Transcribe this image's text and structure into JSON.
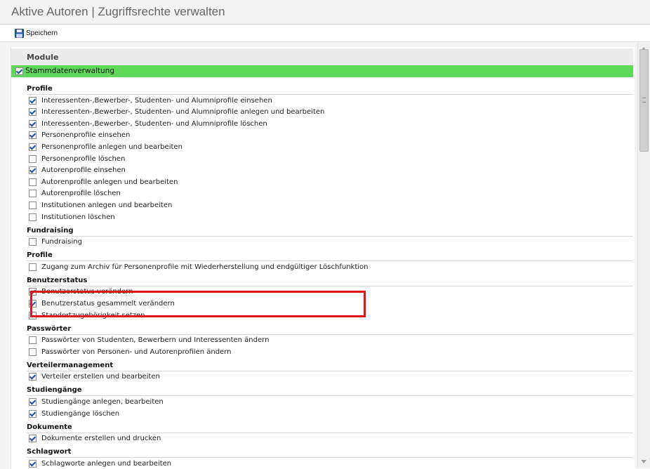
{
  "window": {
    "title": "Aktive Autoren | Zugriffsrechte verwalten"
  },
  "toolbar": {
    "save_label": "Speichern",
    "save_icon": "floppy-disk-icon"
  },
  "module_header": "Module",
  "module": {
    "label": "Stammdatenverwaltung",
    "checked": true,
    "highlight_color": "#5fd95a"
  },
  "groups": [
    {
      "title": "Profile",
      "items": [
        {
          "label": "Interessenten-,Bewerber-, Studenten- und Alumniprofile einsehen",
          "checked": true
        },
        {
          "label": "Interessenten-,Bewerber-, Studenten- und Alumniprofile anlegen und bearbeiten",
          "checked": true
        },
        {
          "label": "Interessenten-,Bewerber-, Studenten- und Alumniprofile löschen",
          "checked": true
        },
        {
          "label": "Personenprofile einsehen",
          "checked": true
        },
        {
          "label": "Personenprofile anlegen und bearbeiten",
          "checked": true
        },
        {
          "label": "Personenprofile löschen",
          "checked": false
        },
        {
          "label": "Autorenprofile einsehen",
          "checked": true
        },
        {
          "label": "Autorenprofile anlegen und bearbeiten",
          "checked": false
        },
        {
          "label": "Autorenprofile löschen",
          "checked": false
        },
        {
          "label": "Institutionen anlegen und bearbeiten",
          "checked": false
        },
        {
          "label": "Institutionen löschen",
          "checked": false
        }
      ]
    },
    {
      "title": "Fundraising",
      "items": [
        {
          "label": "Fundraising",
          "checked": false
        }
      ]
    },
    {
      "title": "Profile",
      "items": [
        {
          "label": "Zugang zum Archiv für Personenprofile mit Wiederherstellung und endgültiger Löschfunktion",
          "checked": false
        }
      ]
    },
    {
      "title": "Benutzerstatus",
      "items": [
        {
          "label": "Benutzerstatus verändern",
          "checked": true
        },
        {
          "label": "Benutzerstatus gesammelt verändern",
          "checked": true
        },
        {
          "label": "Standortzugehörigkeit setzen",
          "checked": false
        }
      ]
    },
    {
      "title": "Passwörter",
      "items": [
        {
          "label": "Passwörter von Studenten, Bewerbern und Interessenten ändern",
          "checked": false
        },
        {
          "label": "Passwörter von Personen- und Autorenprofilen ändern",
          "checked": false
        }
      ]
    },
    {
      "title": "Verteilermanagement",
      "items": [
        {
          "label": "Verteiler erstellen und bearbeiten",
          "checked": true
        }
      ]
    },
    {
      "title": "Studiengänge",
      "items": [
        {
          "label": "Studiengänge anlegen, bearbeiten",
          "checked": true
        },
        {
          "label": "Studiengänge löschen",
          "checked": true
        }
      ]
    },
    {
      "title": "Dokumente",
      "items": [
        {
          "label": "Dokumente erstellen und drucken",
          "checked": true
        }
      ]
    },
    {
      "title": "Schlagwort",
      "items": [
        {
          "label": "Schlagworte anlegen und bearbeiten",
          "checked": true
        }
      ]
    }
  ],
  "highlight_border_color": "#e0151b"
}
